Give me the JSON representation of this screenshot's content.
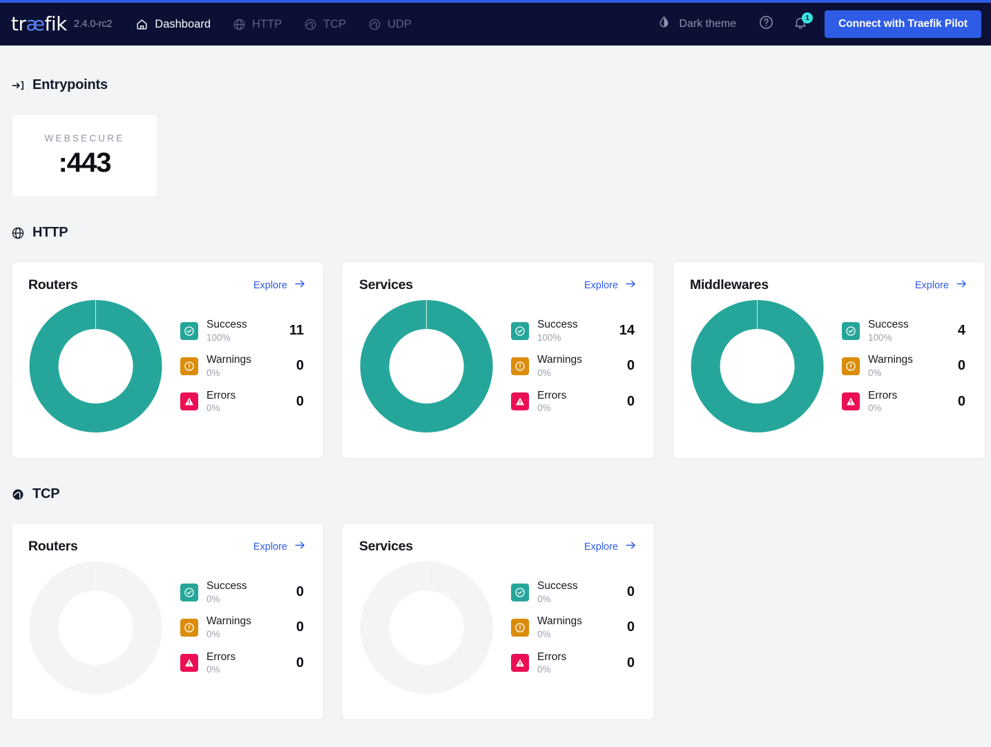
{
  "header": {
    "logo": "træfik",
    "logo_prefix": "tr",
    "logo_ae": "æ",
    "logo_suffix": "fik",
    "version": "2.4.0-rc2",
    "nav": [
      {
        "label": "Dashboard",
        "icon": "home-icon",
        "active": true
      },
      {
        "label": "HTTP",
        "icon": "globe-icon",
        "active": false
      },
      {
        "label": "TCP",
        "icon": "wave-circle-icon",
        "active": false
      },
      {
        "label": "UDP",
        "icon": "wave-circle-icon",
        "active": false
      }
    ],
    "theme_toggle_label": "Dark theme",
    "theme_icon": "droplet-half-icon",
    "help_icon": "question-circle-icon",
    "bell_icon": "bell-icon",
    "notification_count": "1",
    "pilot_button": "Connect with Traefik Pilot",
    "accent_color": "#2f5ce6",
    "bar_color": "#0b1034",
    "badge_color": "#37e5e0"
  },
  "entrypoints": {
    "title": "Entrypoints",
    "icon": "arrow-into-bracket-icon",
    "items": [
      {
        "name": "WEBSECURE",
        "port": ":443"
      }
    ]
  },
  "sections": [
    {
      "title": "HTTP",
      "icon": "globe-icon",
      "cards": [
        {
          "title": "Routers",
          "explore": "Explore",
          "chart_data": {
            "type": "pie",
            "title": "HTTP Routers",
            "categories": [
              "Success",
              "Warnings",
              "Errors"
            ],
            "values": [
              11,
              0,
              0
            ],
            "percents": [
              "100%",
              "0%",
              "0%"
            ],
            "colors": [
              "#26a69a",
              "#db8c0a",
              "#eb0f53"
            ],
            "empty": false
          },
          "stats": [
            {
              "label": "Success",
              "percent": "100%",
              "value": "11",
              "icon": "check-circle-icon",
              "color": "#26a69a"
            },
            {
              "label": "Warnings",
              "percent": "0%",
              "value": "0",
              "icon": "exclamation-circle-icon",
              "color": "#db8c0a"
            },
            {
              "label": "Errors",
              "percent": "0%",
              "value": "0",
              "icon": "warning-triangle-icon",
              "color": "#eb0f53"
            }
          ]
        },
        {
          "title": "Services",
          "explore": "Explore",
          "chart_data": {
            "type": "pie",
            "title": "HTTP Services",
            "categories": [
              "Success",
              "Warnings",
              "Errors"
            ],
            "values": [
              14,
              0,
              0
            ],
            "percents": [
              "100%",
              "0%",
              "0%"
            ],
            "colors": [
              "#26a69a",
              "#db8c0a",
              "#eb0f53"
            ],
            "empty": false
          },
          "stats": [
            {
              "label": "Success",
              "percent": "100%",
              "value": "14",
              "icon": "check-circle-icon",
              "color": "#26a69a"
            },
            {
              "label": "Warnings",
              "percent": "0%",
              "value": "0",
              "icon": "exclamation-circle-icon",
              "color": "#db8c0a"
            },
            {
              "label": "Errors",
              "percent": "0%",
              "value": "0",
              "icon": "warning-triangle-icon",
              "color": "#eb0f53"
            }
          ]
        },
        {
          "title": "Middlewares",
          "explore": "Explore",
          "chart_data": {
            "type": "pie",
            "title": "HTTP Middlewares",
            "categories": [
              "Success",
              "Warnings",
              "Errors"
            ],
            "values": [
              4,
              0,
              0
            ],
            "percents": [
              "100%",
              "0%",
              "0%"
            ],
            "colors": [
              "#26a69a",
              "#db8c0a",
              "#eb0f53"
            ],
            "empty": false
          },
          "stats": [
            {
              "label": "Success",
              "percent": "100%",
              "value": "4",
              "icon": "check-circle-icon",
              "color": "#26a69a"
            },
            {
              "label": "Warnings",
              "percent": "0%",
              "value": "0",
              "icon": "exclamation-circle-icon",
              "color": "#db8c0a"
            },
            {
              "label": "Errors",
              "percent": "0%",
              "value": "0",
              "icon": "warning-triangle-icon",
              "color": "#eb0f53"
            }
          ]
        }
      ]
    },
    {
      "title": "TCP",
      "icon": "wave-circle-icon",
      "cards": [
        {
          "title": "Routers",
          "explore": "Explore",
          "chart_data": {
            "type": "pie",
            "title": "TCP Routers",
            "categories": [
              "Success",
              "Warnings",
              "Errors"
            ],
            "values": [
              0,
              0,
              0
            ],
            "percents": [
              "0%",
              "0%",
              "0%"
            ],
            "colors": [
              "#26a69a",
              "#db8c0a",
              "#eb0f53"
            ],
            "empty": true,
            "empty_color": "#f2f4f6"
          },
          "stats": [
            {
              "label": "Success",
              "percent": "0%",
              "value": "0",
              "icon": "check-circle-icon",
              "color": "#26a69a"
            },
            {
              "label": "Warnings",
              "percent": "0%",
              "value": "0",
              "icon": "exclamation-circle-icon",
              "color": "#db8c0a"
            },
            {
              "label": "Errors",
              "percent": "0%",
              "value": "0",
              "icon": "warning-triangle-icon",
              "color": "#eb0f53"
            }
          ]
        },
        {
          "title": "Services",
          "explore": "Explore",
          "chart_data": {
            "type": "pie",
            "title": "TCP Services",
            "categories": [
              "Success",
              "Warnings",
              "Errors"
            ],
            "values": [
              0,
              0,
              0
            ],
            "percents": [
              "0%",
              "0%",
              "0%"
            ],
            "colors": [
              "#26a69a",
              "#db8c0a",
              "#eb0f53"
            ],
            "empty": true,
            "empty_color": "#f2f4f6"
          },
          "stats": [
            {
              "label": "Success",
              "percent": "0%",
              "value": "0",
              "icon": "check-circle-icon",
              "color": "#26a69a"
            },
            {
              "label": "Warnings",
              "percent": "0%",
              "value": "0",
              "icon": "exclamation-circle-icon",
              "color": "#db8c0a"
            },
            {
              "label": "Errors",
              "percent": "0%",
              "value": "0",
              "icon": "warning-triangle-icon",
              "color": "#eb0f53"
            }
          ]
        }
      ]
    }
  ]
}
